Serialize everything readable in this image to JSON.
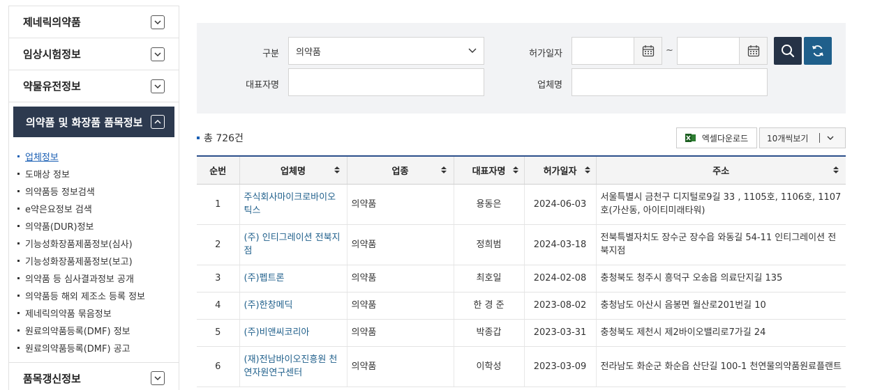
{
  "sidebar": {
    "categories_top": [
      {
        "label": "제네릭의약품"
      },
      {
        "label": "임상시험정보"
      },
      {
        "label": "약물유전정보"
      }
    ],
    "active_category": {
      "label": "의약품 및 화장품 품목정보"
    },
    "sub_items": [
      {
        "label": "업체정보",
        "active": true
      },
      {
        "label": "도매상 정보"
      },
      {
        "label": "의약품등 정보검색"
      },
      {
        "label": "e약은요정보 검색"
      },
      {
        "label": "의약품(DUR)정보"
      },
      {
        "label": "기능성화장품제품정보(심사)"
      },
      {
        "label": "기능성화장품제품정보(보고)"
      },
      {
        "label": "의약품 등 심사결과정보 공개"
      },
      {
        "label": "의약품등 해외 제조소 등록 정보"
      },
      {
        "label": "제네릭의약품 묶음정보"
      },
      {
        "label": "원료의약품등록(DMF) 정보"
      },
      {
        "label": "원료의약품등록(DMF) 공고"
      }
    ],
    "categories_bottom": [
      {
        "label": "품목갱신정보"
      }
    ]
  },
  "search": {
    "type_label": "구분",
    "type_value": "의약품",
    "date_label": "허가일자",
    "date_from": "",
    "date_to": "",
    "date_sep": "~",
    "rep_label": "대표자명",
    "rep_value": "",
    "company_label": "업체명",
    "company_value": ""
  },
  "summary": {
    "total": "총 726건",
    "excel_label": "엑셀다운로드",
    "perpage_label": "10개씩보기"
  },
  "table": {
    "headers": [
      "순번",
      "업체명",
      "업종",
      "대표자명",
      "허가일자",
      "주소"
    ],
    "rows": [
      {
        "no": "1",
        "company": "주식회사마이크로바이오틱스",
        "type": "의약품",
        "rep": "용동은",
        "date": "2024-06-03",
        "addr": "서울특별시 금천구 디지털로9길 33 , 1105호, 1106호, 1107호(가산동, 아이티미래타워)"
      },
      {
        "no": "2",
        "company": "(주) 인티그레이션 전북지점",
        "type": "의약품",
        "rep": "정희범",
        "date": "2024-03-18",
        "addr": "전북특별자치도 장수군 장수읍 와동길 54-11 인티그레이션 전북지점"
      },
      {
        "no": "3",
        "company": "(주)펩트론",
        "type": "의약품",
        "rep": "최호일",
        "date": "2024-02-08",
        "addr": "충청북도 청주시 흥덕구 오송읍 의료단지길 135"
      },
      {
        "no": "4",
        "company": "(주)한창메딕",
        "type": "의약품",
        "rep": "한 경 준",
        "date": "2023-08-02",
        "addr": "충청남도 아산시 음봉면 월산로201번길 10"
      },
      {
        "no": "5",
        "company": "(주)비앤씨코리아",
        "type": "의약품",
        "rep": "박종갑",
        "date": "2023-03-31",
        "addr": "충청북도 제천시 제2바이오밸리로7가길 24"
      },
      {
        "no": "6",
        "company": "(재)전남바이오진흥원 천연자원연구센터",
        "type": "의약품",
        "rep": "이학성",
        "date": "2023-03-09",
        "addr": "전라남도 화순군 화순읍 산단길 100-1 천연물의약품원료플랜트"
      }
    ]
  }
}
